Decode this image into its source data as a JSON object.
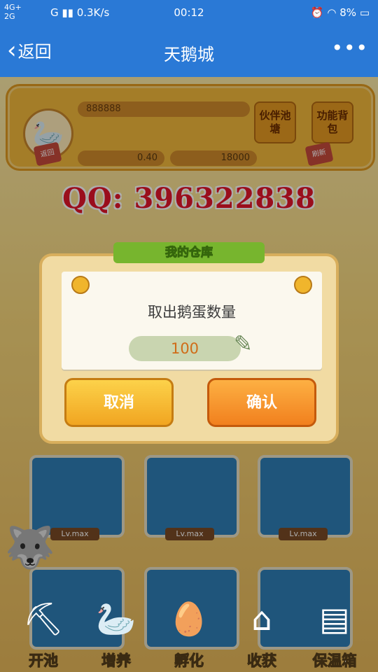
{
  "statusbar": {
    "net1": "4G+",
    "net2": "2G",
    "carrier": "G",
    "speed": "0.3K/s",
    "time": "00:12",
    "battery": "8%"
  },
  "titlebar": {
    "back_label": "返回",
    "title": "天鹅城"
  },
  "hud": {
    "id": "888888",
    "btn_partner": "伙伴池塘",
    "btn_bag": "功能背包",
    "egg_value": "0.40",
    "gold_value": "18000",
    "kite_back": "返回",
    "kite_refresh": "刷新"
  },
  "watermark": "QQ: 396322838",
  "ponds": {
    "level_label": "Lv.max"
  },
  "toolbar": {
    "items": [
      {
        "label": "开池",
        "icon": "pond-dig-icon"
      },
      {
        "label": "增养",
        "icon": "swan-feed-icon"
      },
      {
        "label": "孵化",
        "icon": "hatch-egg-icon"
      },
      {
        "label": "收获",
        "icon": "harvest-house-icon"
      },
      {
        "label": "保温箱",
        "icon": "incubator-icon"
      }
    ]
  },
  "dialog": {
    "banner": "我的仓库",
    "prompt": "取出鹅蛋数量",
    "quantity": "100",
    "cancel_label": "取消",
    "confirm_label": "确认"
  }
}
